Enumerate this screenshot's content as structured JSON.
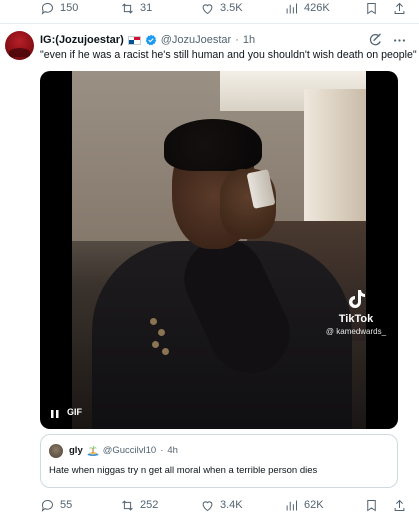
{
  "top_actions": {
    "replies": "150",
    "reposts": "31",
    "likes": "3.5K",
    "views": "426K"
  },
  "tweet": {
    "display_name": "IG:(Jozujoestar)",
    "handle": "@JozuJoestar",
    "separator": "·",
    "time": "1h",
    "text": "\"even if he was a racist he's still human and you shouldn't wish death on people\""
  },
  "media": {
    "watermark_brand": "TikTok",
    "watermark_handle": "@ kamedwards_",
    "badge": "GIF",
    "pause_icon": "pause-icon"
  },
  "quote": {
    "display_name": "gly",
    "handle": "@Guccilvl10",
    "separator": "·",
    "time": "4h",
    "text": "Hate when niggas try n get all moral when a terrible person dies"
  },
  "bottom_actions": {
    "replies": "55",
    "reposts": "252",
    "likes": "3.4K",
    "views": "62K"
  },
  "colors": {
    "text_primary": "#0f1419",
    "text_secondary": "#536471",
    "border": "#cfd9de",
    "verified": "#1d9bf0"
  }
}
